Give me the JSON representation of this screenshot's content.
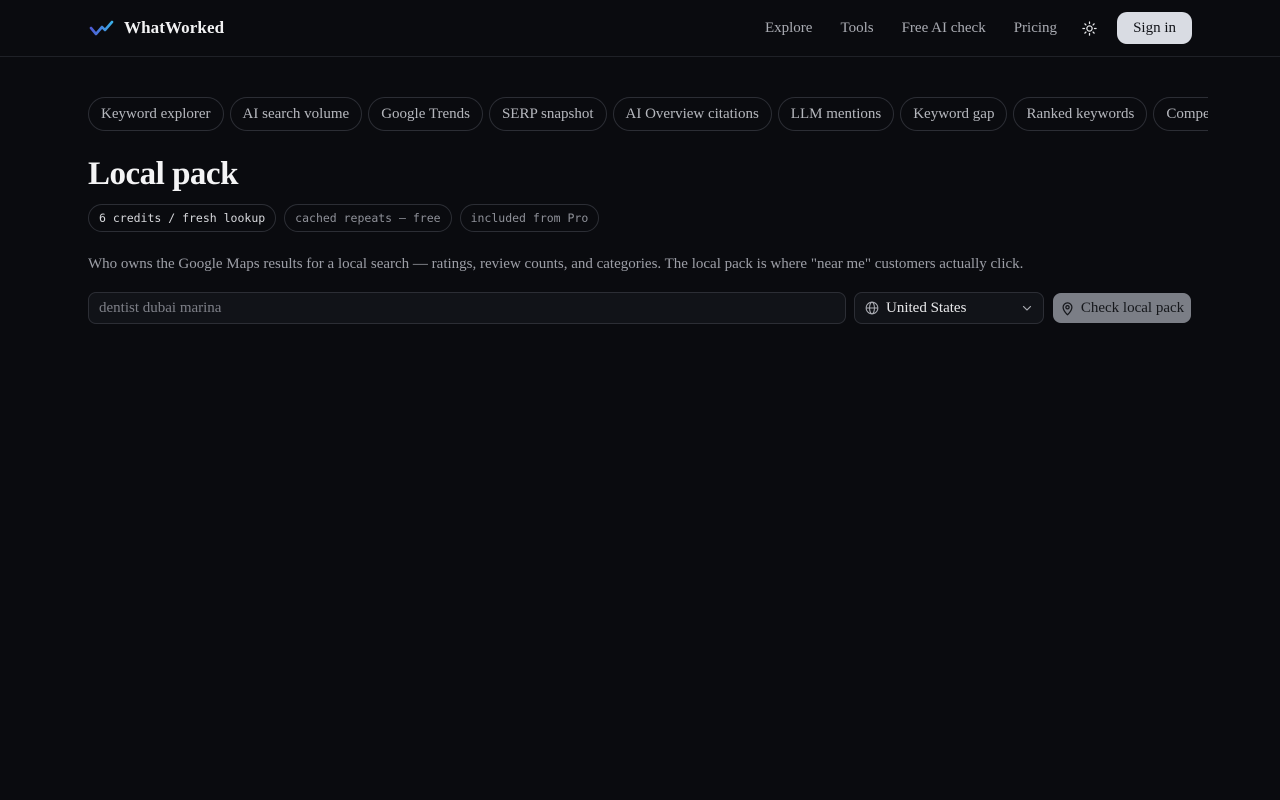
{
  "brand": {
    "name": "WhatWorked",
    "logo_icon": "trend-line-icon"
  },
  "nav": {
    "items": [
      {
        "label": "Explore"
      },
      {
        "label": "Tools"
      },
      {
        "label": "Free AI check"
      },
      {
        "label": "Pricing"
      }
    ],
    "theme_icon": "sun-icon",
    "signin_label": "Sign in"
  },
  "tools": {
    "chips": [
      {
        "label": "Keyword explorer"
      },
      {
        "label": "AI search volume"
      },
      {
        "label": "Google Trends"
      },
      {
        "label": "SERP snapshot"
      },
      {
        "label": "AI Overview citations"
      },
      {
        "label": "LLM mentions"
      },
      {
        "label": "Keyword gap"
      },
      {
        "label": "Ranked keywords"
      },
      {
        "label": "Competitors"
      },
      {
        "label": ""
      }
    ]
  },
  "page": {
    "title": "Local pack",
    "badges": [
      {
        "label": "6 credits / fresh lookup"
      },
      {
        "label": "cached repeats — free"
      },
      {
        "label": "included from Pro"
      }
    ],
    "description": "Who owns the Google Maps results for a local search — ratings, review counts, and categories. The local pack is where \"near me\" customers actually click."
  },
  "search": {
    "value": "",
    "placeholder": "dentist dubai marina",
    "country_icon": "globe-icon",
    "country": "United States",
    "dropdown_icon": "chevron-down-icon",
    "submit_icon": "map-pin-icon",
    "submit_label": "Check local pack"
  },
  "colors": {
    "background": "#0a0b0f",
    "accent_logo_start": "#4f5bd5",
    "accent_logo_end": "#3ab0e8",
    "signin_bg": "#d9dce3",
    "submit_bg": "#7b7e86"
  }
}
